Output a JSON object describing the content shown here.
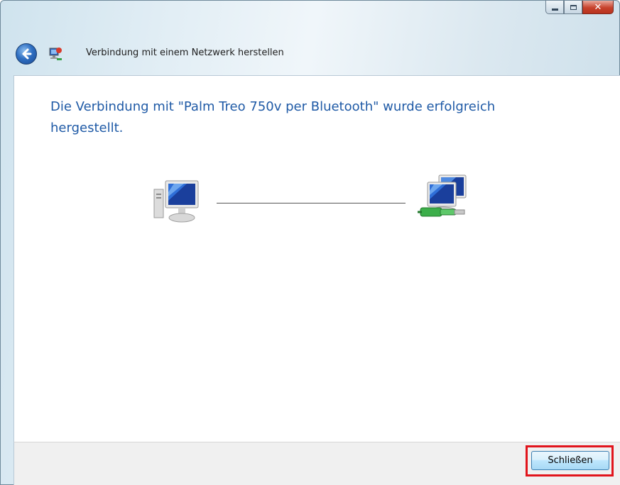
{
  "window": {
    "title": "Verbindung mit einem Netzwerk herstellen",
    "caption_buttons": [
      "minimize-icon",
      "maximize-icon",
      "close-icon"
    ]
  },
  "content": {
    "message": "Die Verbindung mit \"Palm Treo 750v per Bluetooth\" wurde erfolgreich hergestellt.",
    "left_icon": "computer-icon",
    "right_icon": "network-icon"
  },
  "footer": {
    "close_label": "Schließen"
  },
  "colors": {
    "message_text": "#1f5aa6",
    "highlight": "#e1141c"
  }
}
